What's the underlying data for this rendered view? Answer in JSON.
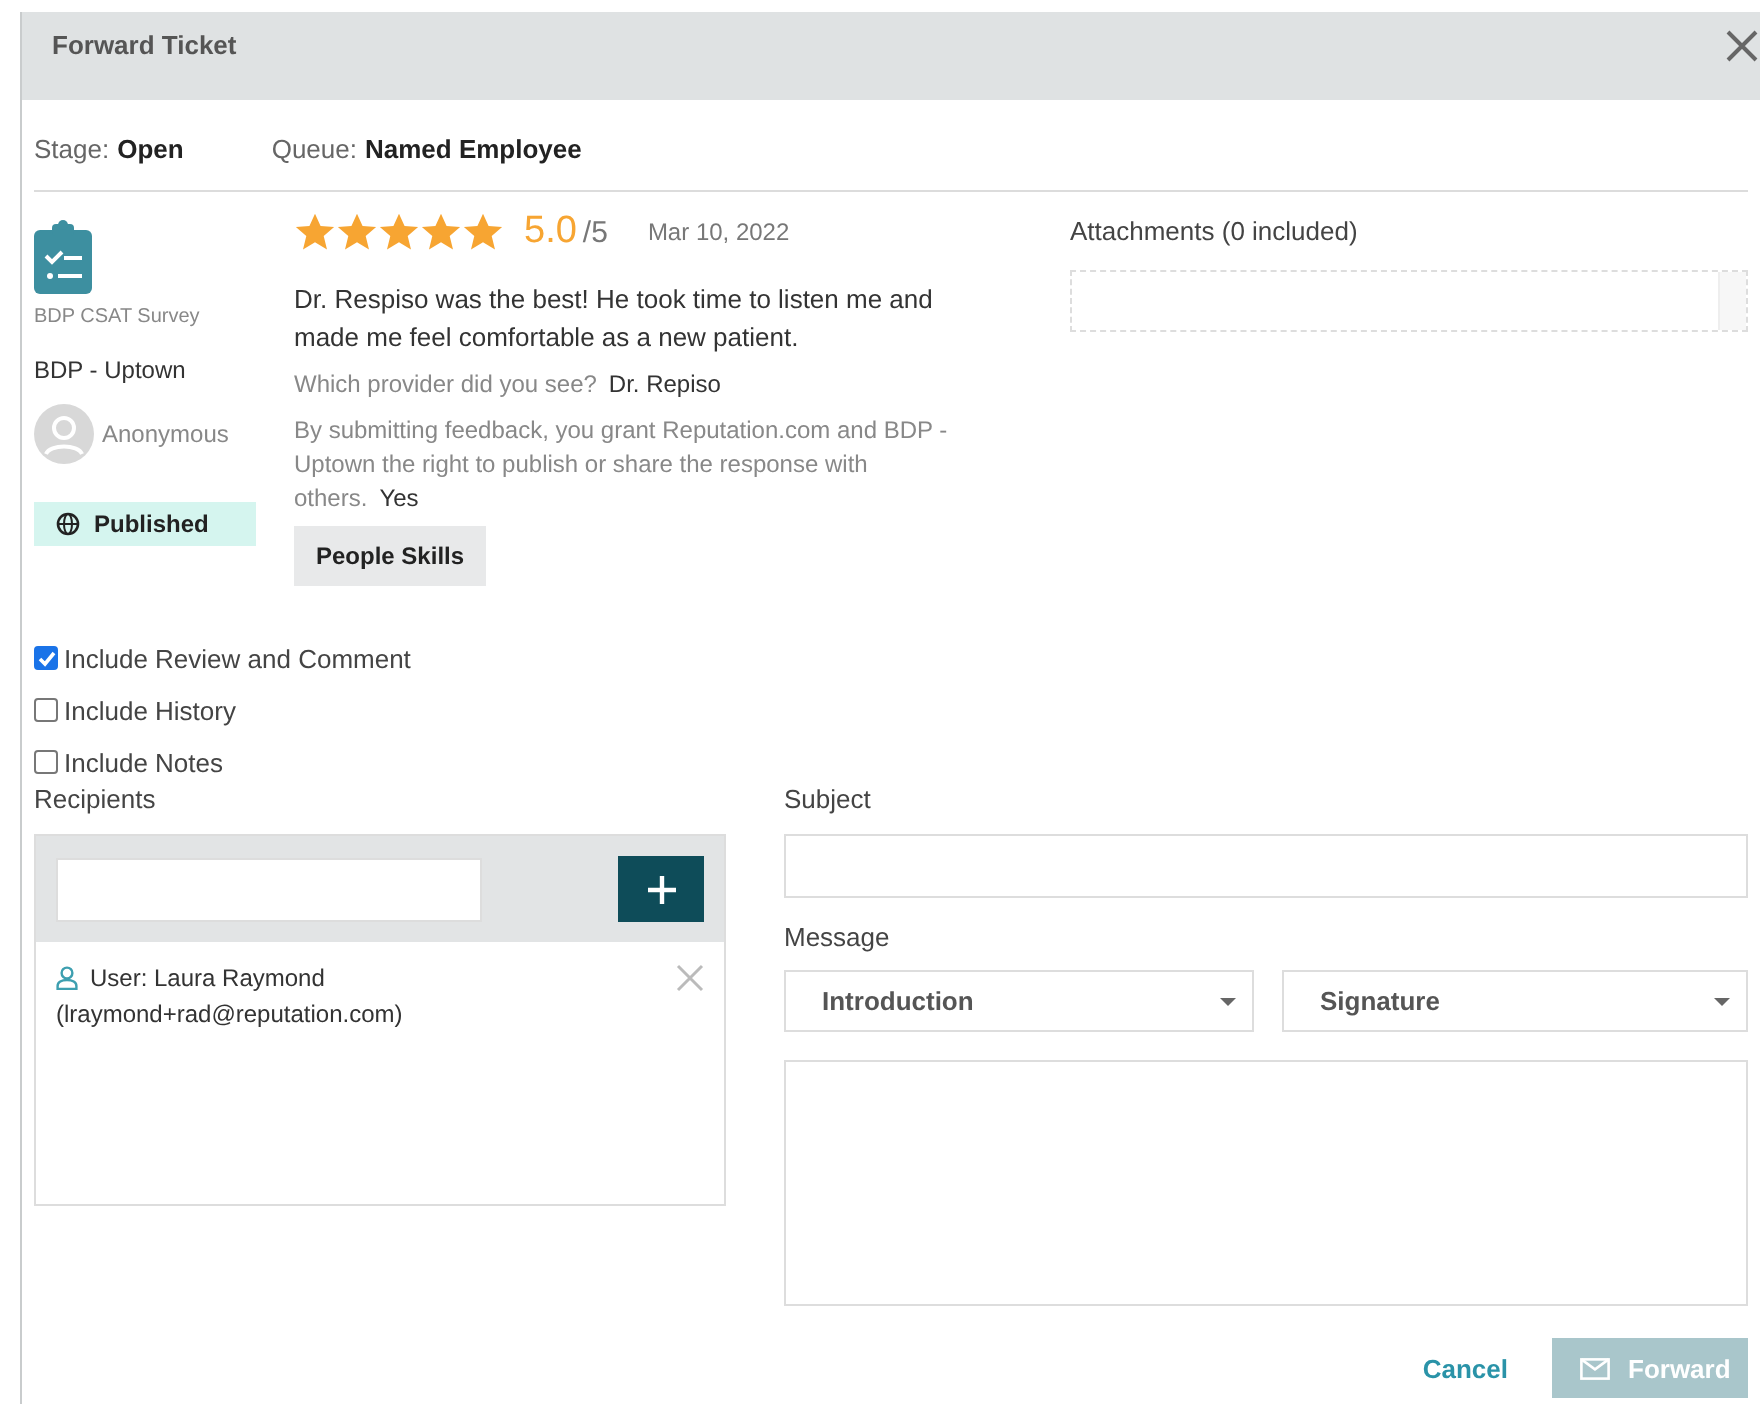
{
  "dialog": {
    "title": "Forward Ticket"
  },
  "meta": [
    {
      "label": "Stage:",
      "value": "Open"
    },
    {
      "label": "Queue:",
      "value": "Named Employee"
    }
  ],
  "review": {
    "source": "BDP CSAT Survey",
    "location": "BDP - Uptown",
    "author": "Anonymous",
    "status": "Published",
    "stars": 5,
    "rating": "5.0",
    "out_of": "/5",
    "date": "Mar 10, 2022",
    "comment": "Dr. Respiso was the best! He took time to listen me and made me feel comfortable as a new patient.",
    "answers": [
      {
        "question": "Which provider did you see?",
        "answer": "Dr. Repiso"
      },
      {
        "question": "By submitting feedback, you grant Reputation.com and BDP - Uptown the right to publish or share the response with others.",
        "answer": "Yes"
      }
    ],
    "tags": [
      "People Skills"
    ]
  },
  "attachments": {
    "label": "Attachments (0 included)"
  },
  "options": [
    {
      "label": "Include Review and Comment",
      "checked": true
    },
    {
      "label": "Include History",
      "checked": false
    },
    {
      "label": "Include Notes",
      "checked": false
    }
  ],
  "recipients": {
    "label": "Recipients",
    "items": [
      {
        "name": "User: Laura Raymond",
        "email": "(lraymond+rad@reputation.com)"
      }
    ]
  },
  "subject": {
    "label": "Subject"
  },
  "message": {
    "label": "Message",
    "selects": [
      "Introduction",
      "Signature"
    ]
  },
  "actions": {
    "cancel": "Cancel",
    "submit": "Forward",
    "submit_disabled": true
  }
}
